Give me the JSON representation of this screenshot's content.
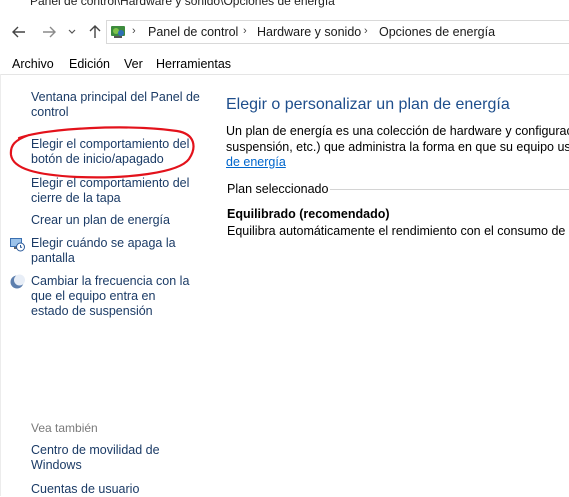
{
  "window": {
    "title": "Panel de control\\Hardware y sonido\\Opciones de energía"
  },
  "address_bar": {
    "breadcrumbs": [
      "Panel de control",
      "Hardware y sonido",
      "Opciones de energía"
    ]
  },
  "menu": [
    "Archivo",
    "Edición",
    "Ver",
    "Herramientas"
  ],
  "sidebar": {
    "items": [
      {
        "label": "Ventana principal del Panel de control",
        "icon": null
      },
      {
        "label": "Elegir el comportamiento del botón de inicio/apagado",
        "icon": null
      },
      {
        "label": "Elegir el comportamiento del cierre de la tapa",
        "icon": null
      },
      {
        "label": "Crear un plan de energía",
        "icon": null
      },
      {
        "label": "Elegir cuándo se apaga la pantalla",
        "icon": "monitor-clock-icon"
      },
      {
        "label": "Cambiar la frecuencia con la que el equipo entra en estado de suspensión",
        "icon": "moon-icon"
      }
    ],
    "see_also": {
      "heading": "Vea también",
      "items": [
        "Centro de movilidad de Windows",
        "Cuentas de usuario"
      ]
    }
  },
  "main": {
    "title": "Elegir o personalizar un plan de energía",
    "description_line1": "Un plan de energía es una colección de hardware y configuracion",
    "description_line2": "suspensión, etc.) que administra la forma en que su equipo usa la",
    "description_link": "de energía",
    "section_label": "Plan seleccionado",
    "plan_name": "Equilibrado (recomendado)",
    "plan_description": "Equilibra automáticamente el rendimiento con el consumo de en"
  },
  "annotation": {
    "color": "#e3121b"
  }
}
